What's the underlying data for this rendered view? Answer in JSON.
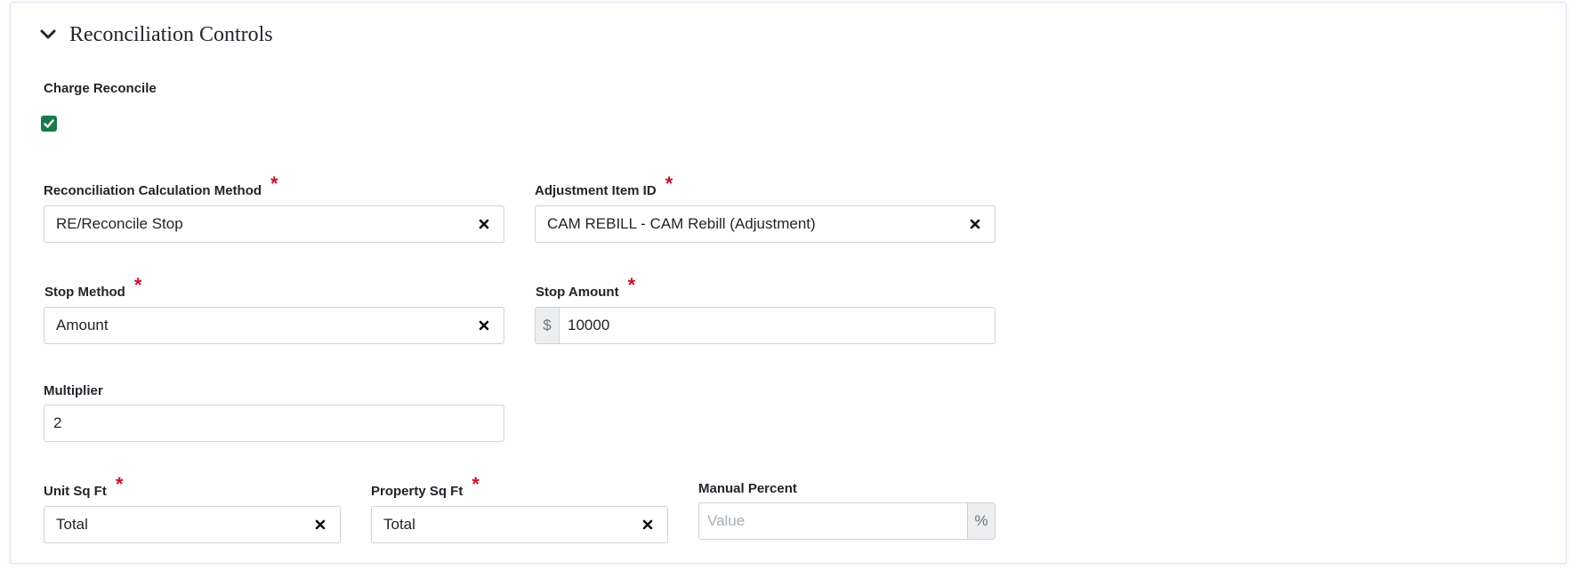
{
  "section": {
    "title": "Reconciliation Controls"
  },
  "charge_reconcile": {
    "label": "Charge Reconcile",
    "checked": true
  },
  "fields": {
    "calc_method": {
      "label": "Reconciliation Calculation Method",
      "required_mark": "*",
      "value": "RE/Reconcile Stop"
    },
    "adjustment_item": {
      "label": "Adjustment Item ID",
      "required_mark": "*",
      "value": "CAM REBILL - CAM Rebill (Adjustment)"
    },
    "stop_method": {
      "label": "Stop Method",
      "required_mark": "*",
      "value": "Amount"
    },
    "stop_amount": {
      "label": "Stop Amount",
      "required_mark": "*",
      "prefix": "$",
      "value": "10000"
    },
    "multiplier": {
      "label": "Multiplier",
      "value": "2"
    },
    "unit_sq_ft": {
      "label": "Unit Sq Ft",
      "required_mark": "*",
      "value": "Total"
    },
    "property_sq_ft": {
      "label": "Property Sq Ft",
      "required_mark": "*",
      "value": "Total"
    },
    "manual_percent": {
      "label": "Manual Percent",
      "placeholder": "Value",
      "suffix": "%"
    }
  },
  "icons": {
    "section_toggle": "chevron-down-icon",
    "clear": "close-icon",
    "checkbox": "checkmark-icon"
  },
  "colors": {
    "checkbox": "#1a7a4a",
    "required": "#c8102e"
  }
}
